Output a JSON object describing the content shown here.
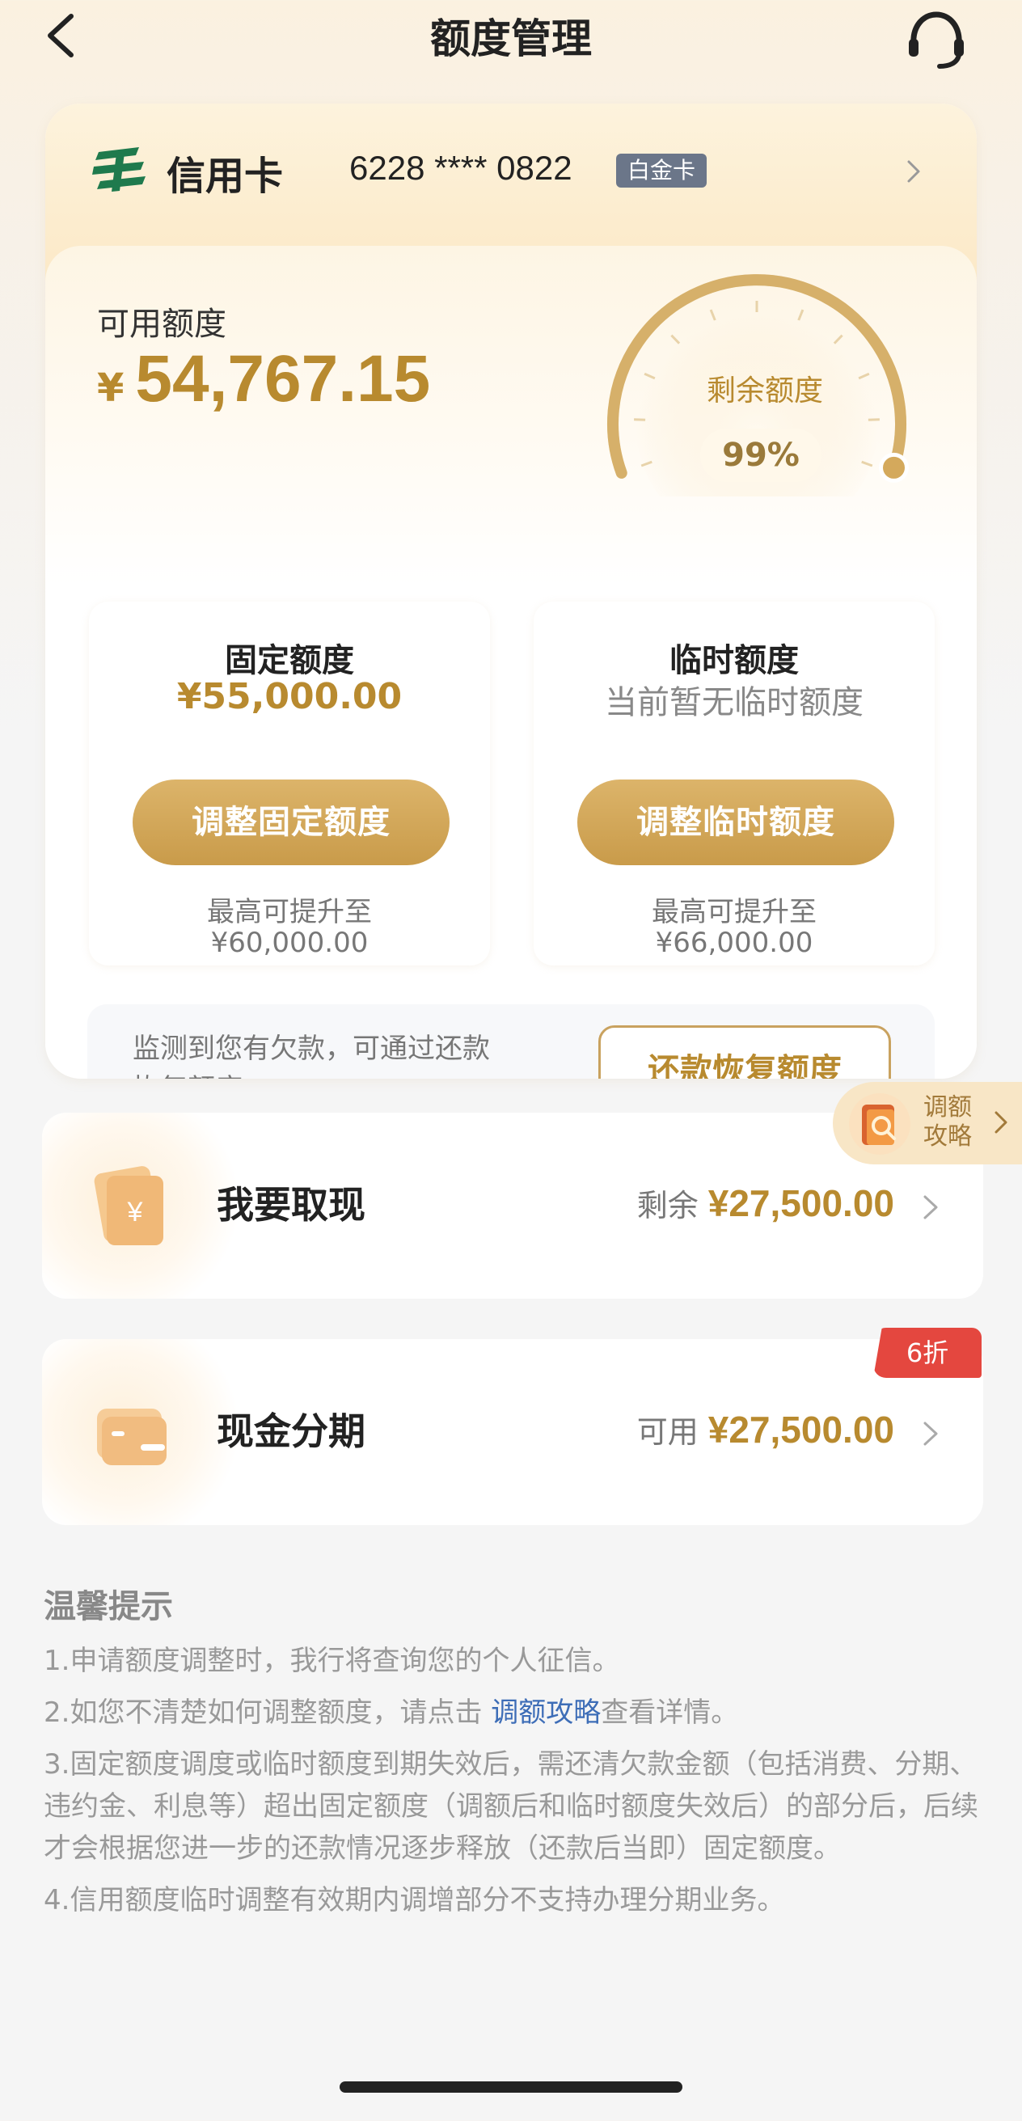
{
  "header": {
    "title": "额度管理",
    "back_icon": "chevron-left-icon",
    "service_icon": "headset-icon"
  },
  "card": {
    "name": "信用卡",
    "number": "6228 **** 0822",
    "level": "白金卡",
    "logo_icon": "postal-bank-logo"
  },
  "available": {
    "label": "可用额度",
    "currency": "¥",
    "amount": "54,767.15"
  },
  "gauge": {
    "label": "剩余额度",
    "percent_text": "99%",
    "percent_value": 99,
    "color": "#c99b4a"
  },
  "fixed_quota": {
    "title": "固定额度",
    "value": "¥55,000.00",
    "button": "调整固定额度",
    "max_label": "最高可提升至",
    "max_value": "¥60,000.00"
  },
  "temp_quota": {
    "title": "临时额度",
    "value": "当前暂无临时额度",
    "button": "调整临时额度",
    "max_label": "最高可提升至",
    "max_value": "¥66,000.00"
  },
  "notice": {
    "text": "监测到您有欠款，可通过还款恢复额度。",
    "button": "还款恢复额度"
  },
  "guide": {
    "label": "调额攻略"
  },
  "rows": [
    {
      "title": "我要取现",
      "prefix": "剩余",
      "amount": "¥27,500.00",
      "icon": "cash-card-icon"
    },
    {
      "title": "现金分期",
      "prefix": "可用",
      "amount": "¥27,500.00",
      "icon": "wallet-icon",
      "badge": "6折"
    }
  ],
  "tips": {
    "title": "温馨提示",
    "tip1": "1.申请额度调整时，我行将查询您的个人征信。",
    "tip2_before": "2.如您不清楚如何调整额度，请点击",
    "tip2_link": "调额攻略",
    "tip2_after": "查看详情。",
    "tip3": "3.固定额度调度或临时额度到期失效后，需还清欠款金额（包括消费、分期、违约金、利息等）超出固定额度（调额后和临时额度失效后）的部分后，后续才会根据您进一步的还款情况逐步释放（还款后当即）固定额度。",
    "tip4": "4.信用额度临时调整有效期内调增部分不支持办理分期业务。"
  },
  "colors": {
    "gold": "#b88a2f",
    "badge_red": "#e4473f",
    "link_blue": "#3d6db7",
    "level_badge": "#6b7689"
  }
}
